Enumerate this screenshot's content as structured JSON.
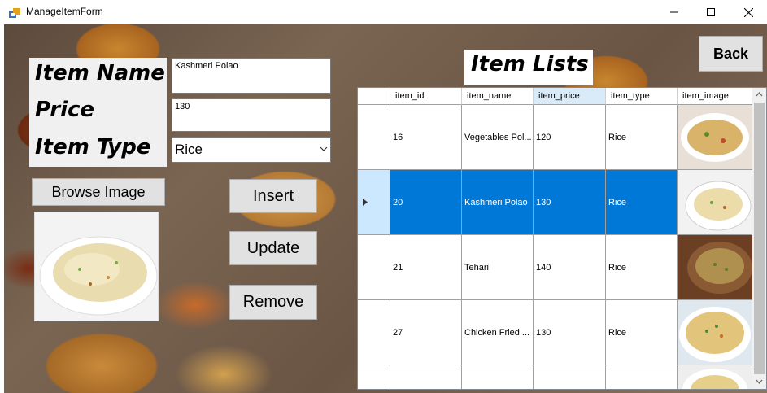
{
  "window": {
    "title": "ManageItemForm"
  },
  "form": {
    "labels": {
      "item_name": "Item Name",
      "price": "Price",
      "item_type": "Item Type"
    },
    "item_name_value": "Kashmeri Polao",
    "price_value": "130",
    "item_type_value": "Rice",
    "browse_button": "Browse Image",
    "insert_button": "Insert",
    "update_button": "Update",
    "remove_button": "Remove",
    "back_button": "Back",
    "list_title": "Item Lists"
  },
  "grid": {
    "columns": [
      "item_id",
      "item_name",
      "item_price",
      "item_type",
      "item_image"
    ],
    "rows": [
      {
        "item_id": "16",
        "item_name": "Vegetables Pol...",
        "item_price": "120",
        "item_type": "Rice"
      },
      {
        "item_id": "20",
        "item_name": "Kashmeri Polao",
        "item_price": "130",
        "item_type": "Rice"
      },
      {
        "item_id": "21",
        "item_name": "Tehari",
        "item_price": "140",
        "item_type": "Rice"
      },
      {
        "item_id": "27",
        "item_name": "Chicken Fried ...",
        "item_price": "130",
        "item_type": "Rice"
      }
    ],
    "selected_row": 1
  },
  "colors": {
    "selection": "#0078d7",
    "button_face": "#e1e1e1",
    "label_panel": "#f0f0f0"
  },
  "icons": [
    "app-icon",
    "minimize-icon",
    "maximize-icon",
    "close-icon",
    "dropdown-chevron-icon",
    "row-pointer-icon",
    "scroll-up-icon",
    "scroll-down-icon"
  ]
}
